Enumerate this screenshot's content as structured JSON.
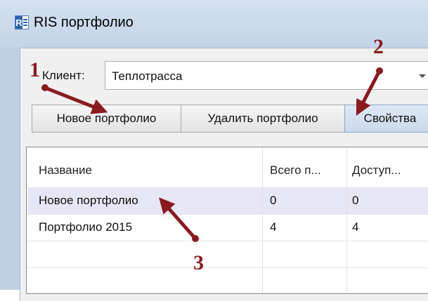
{
  "window": {
    "title": "RIS портфолио"
  },
  "client": {
    "label": "Клиент:",
    "value": "Теплотрасса"
  },
  "toolbar": {
    "new_label": "Новое портфолио",
    "delete_label": "Удалить портфолио",
    "props_label": "Свойства"
  },
  "grid": {
    "columns": [
      "Название",
      "Всего п...",
      "Доступ..."
    ],
    "rows": [
      [
        "Новое портфолио",
        "0",
        "0"
      ],
      [
        "Портфолио 2015",
        "4",
        "4"
      ]
    ]
  },
  "annotations": {
    "n1": "1",
    "n2": "2",
    "n3": "3",
    "color": "#8b1a1f"
  }
}
